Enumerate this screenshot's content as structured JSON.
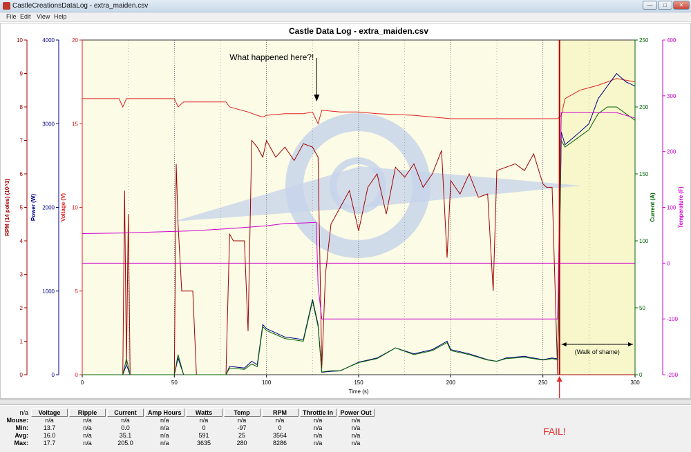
{
  "window": {
    "title": "CastleCreationsDataLog - extra_maiden.csv"
  },
  "menu": [
    "File",
    "Edit",
    "View",
    "Help"
  ],
  "chart": {
    "title": "Castle Data Log - extra_maiden.csv",
    "xlabel": "Time (s)",
    "annotation_question": "What happened here?!",
    "annotation_walk": "(Walk of shame)",
    "annotation_fail": "FAIL!",
    "colors": {
      "rpm": "#a00000",
      "power": "#000080",
      "voltage": "#e02020",
      "current": "#006400",
      "temperature": "#cc00cc",
      "plot_bg": "#fbfbe6",
      "plot_bg_after": "#f8f7cc"
    }
  },
  "chart_data": {
    "type": "line",
    "title": "Castle Data Log - extra_maiden.csv",
    "xlabel": "Time (s)",
    "xlim": [
      0,
      300
    ],
    "xticks": [
      0,
      50,
      100,
      150,
      200,
      250,
      300
    ],
    "axes": [
      {
        "name": "RPM (14 poles) (10^3)",
        "side": "left",
        "lim": [
          0,
          10
        ],
        "ticks": [
          0,
          1,
          2,
          3,
          4,
          5,
          6,
          7,
          8,
          9,
          10
        ]
      },
      {
        "name": "Power (W)",
        "side": "left",
        "lim": [
          0,
          4000
        ],
        "ticks": [
          0,
          1000,
          2000,
          3000,
          4000
        ]
      },
      {
        "name": "Voltage (V)",
        "side": "left",
        "lim": [
          0,
          20
        ],
        "ticks": [
          0,
          5,
          10,
          15,
          20
        ]
      },
      {
        "name": "Current (A)",
        "side": "right",
        "lim": [
          0,
          250
        ],
        "ticks": [
          0,
          50,
          100,
          150,
          200,
          250
        ]
      },
      {
        "name": "Temperature (F)",
        "side": "right",
        "lim": [
          -200,
          400
        ],
        "ticks": [
          -200,
          -100,
          0,
          100,
          200,
          300,
          400
        ]
      }
    ],
    "series": [
      {
        "name": "Voltage",
        "axis": "Voltage (V)",
        "x": [
          0,
          20,
          22,
          24,
          26,
          50,
          52,
          55,
          78,
          80,
          90,
          95,
          98,
          100,
          110,
          120,
          125,
          128,
          130,
          140,
          150,
          160,
          180,
          200,
          220,
          240,
          250,
          258,
          260,
          262,
          270,
          280,
          290,
          300
        ],
        "y": [
          16.5,
          16.5,
          16.0,
          16.5,
          16.5,
          16.5,
          16.0,
          16.3,
          16.3,
          16.0,
          15.7,
          15.5,
          15.4,
          15.5,
          15.6,
          15.6,
          15.7,
          15.0,
          15.8,
          15.7,
          15.7,
          15.6,
          15.5,
          15.3,
          15.3,
          15.3,
          15.3,
          15.3,
          15.5,
          16.5,
          17.0,
          17.3,
          17.7,
          17.5
        ]
      },
      {
        "name": "RPM",
        "axis": "RPM (14 poles) (10^3)",
        "x": [
          0,
          22,
          23,
          24,
          25,
          26,
          50,
          51,
          52,
          54,
          60,
          62,
          78,
          80,
          82,
          88,
          90,
          92,
          95,
          98,
          100,
          105,
          110,
          115,
          120,
          125,
          128,
          130,
          132,
          135,
          140,
          145,
          150,
          155,
          160,
          165,
          170,
          175,
          180,
          185,
          190,
          195,
          198,
          200,
          205,
          210,
          215,
          220,
          223,
          225,
          230,
          235,
          240,
          245,
          250,
          252,
          255,
          258,
          260,
          261,
          262,
          270,
          280,
          290,
          300
        ],
        "y": [
          0,
          0,
          5.5,
          0.3,
          4.8,
          0,
          0,
          6.3,
          4.5,
          2.5,
          2.5,
          0,
          0,
          4.2,
          4.0,
          4.0,
          1.3,
          7.0,
          6.8,
          6.5,
          7.0,
          6.5,
          6.8,
          6.4,
          6.9,
          6.8,
          6.5,
          0.2,
          3.0,
          4.5,
          5.0,
          5.5,
          4.3,
          5.6,
          6.0,
          4.8,
          6.2,
          5.9,
          6.3,
          5.6,
          6.0,
          6.7,
          3.5,
          5.8,
          5.4,
          6.0,
          5.3,
          5.4,
          2.5,
          6.1,
          6.2,
          6.3,
          6.1,
          6.6,
          5.7,
          5.6,
          5.6,
          0,
          0,
          0,
          0,
          0,
          0,
          0,
          0
        ]
      },
      {
        "name": "Power",
        "axis": "Power (W)",
        "x": [
          0,
          22,
          24,
          26,
          50,
          52,
          55,
          78,
          80,
          88,
          92,
          95,
          98,
          100,
          110,
          120,
          125,
          128,
          130,
          135,
          140,
          150,
          160,
          170,
          180,
          190,
          198,
          200,
          210,
          220,
          225,
          230,
          240,
          250,
          255,
          258,
          260,
          262,
          270,
          275,
          280,
          285,
          290,
          295,
          300
        ],
        "y": [
          0,
          0,
          120,
          0,
          0,
          200,
          0,
          0,
          100,
          80,
          160,
          120,
          600,
          550,
          450,
          420,
          900,
          600,
          30,
          40,
          45,
          150,
          200,
          320,
          250,
          300,
          400,
          300,
          250,
          180,
          160,
          200,
          220,
          180,
          200,
          190,
          2900,
          2750,
          2900,
          3000,
          3300,
          3450,
          3600,
          3500,
          3450
        ]
      },
      {
        "name": "Current",
        "axis": "Current (A)",
        "x": [
          0,
          22,
          24,
          26,
          50,
          52,
          55,
          78,
          80,
          88,
          92,
          95,
          98,
          100,
          110,
          120,
          125,
          128,
          130,
          135,
          140,
          150,
          160,
          170,
          180,
          190,
          198,
          200,
          210,
          220,
          225,
          230,
          240,
          250,
          255,
          258,
          260,
          262,
          270,
          275,
          280,
          285,
          290,
          295,
          300
        ],
        "y": [
          0,
          0,
          12,
          0,
          0,
          15,
          0,
          0,
          5,
          4,
          8,
          6,
          36,
          33,
          27,
          25,
          55,
          36,
          2,
          3,
          3,
          9,
          12,
          20,
          15,
          18,
          24,
          18,
          15,
          11,
          10,
          12,
          13,
          11,
          12,
          11,
          175,
          170,
          178,
          183,
          195,
          200,
          200,
          195,
          190
        ]
      },
      {
        "name": "Temperature",
        "axis": "Temperature (F)",
        "x": [
          0,
          20,
          40,
          60,
          80,
          100,
          110,
          120,
          127,
          128,
          130,
          150,
          200,
          258,
          260,
          262,
          270,
          280,
          290,
          300
        ],
        "y": [
          53,
          54,
          56,
          58,
          62,
          67,
          71,
          72,
          73,
          -40,
          -100,
          -100,
          -100,
          -100,
          270,
          270,
          270,
          270,
          270,
          260
        ]
      }
    ],
    "reference_line": {
      "axis": "Temperature (F)",
      "y": 0
    },
    "annotations": [
      {
        "text": "What happened here?!",
        "x": 128
      },
      {
        "text": "(Walk of shame)",
        "x_range": [
          259,
          300
        ]
      },
      {
        "text": "FAIL!",
        "x": 259
      }
    ]
  },
  "stats": {
    "corner": "n/a",
    "columns": [
      "Voltage",
      "Ripple",
      "Current",
      "Amp Hours",
      "Watts",
      "Temp",
      "RPM",
      "Throttle In",
      "Power Out"
    ],
    "rows": [
      {
        "label": "Mouse:",
        "values": [
          "n/a",
          "n/a",
          "n/a",
          "n/a",
          "n/a",
          "n/a",
          "n/a",
          "n/a",
          "n/a"
        ]
      },
      {
        "label": "Min:",
        "values": [
          "13.7",
          "n/a",
          "0.0",
          "n/a",
          "0",
          "-97",
          "0",
          "n/a",
          "n/a"
        ]
      },
      {
        "label": "Avg:",
        "values": [
          "16.0",
          "n/a",
          "35.1",
          "n/a",
          "591",
          "25",
          "3564",
          "n/a",
          "n/a"
        ]
      },
      {
        "label": "Max:",
        "values": [
          "17.7",
          "n/a",
          "205.0",
          "n/a",
          "3635",
          "280",
          "8286",
          "n/a",
          "n/a"
        ]
      }
    ]
  }
}
